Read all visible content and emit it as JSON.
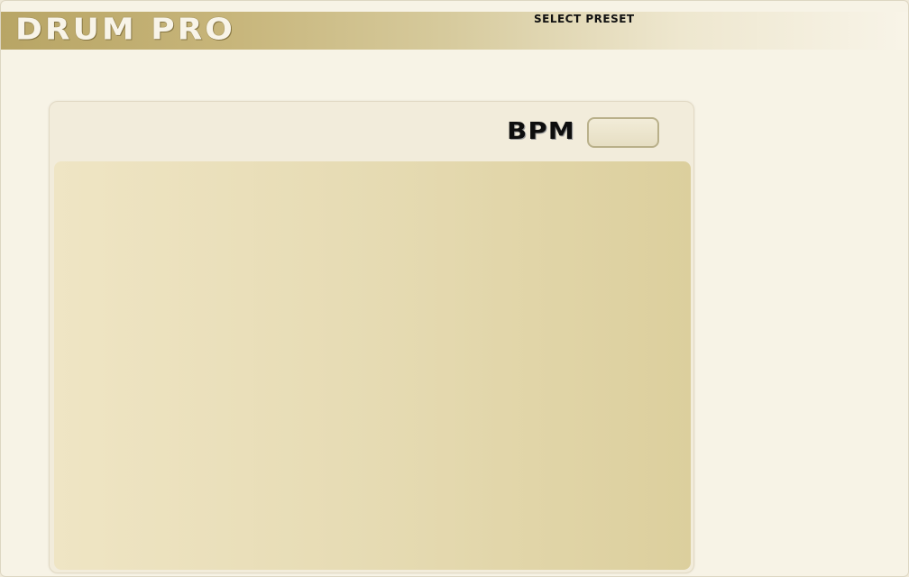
{
  "app": {
    "title": "DRUM PRO"
  },
  "header": {
    "select_preset_label": "SELECT PRESET"
  },
  "tempo": {
    "label": "BPM",
    "value": ""
  },
  "colors": {
    "header_gradient_start": "#b8a565",
    "header_gradient_end": "#f8f4e8",
    "background": "#f7f3e6",
    "panel": "#f2ecdb",
    "content_start": "#efe5c4",
    "content_end": "#dccf9d",
    "input_border": "#b9b08a"
  }
}
